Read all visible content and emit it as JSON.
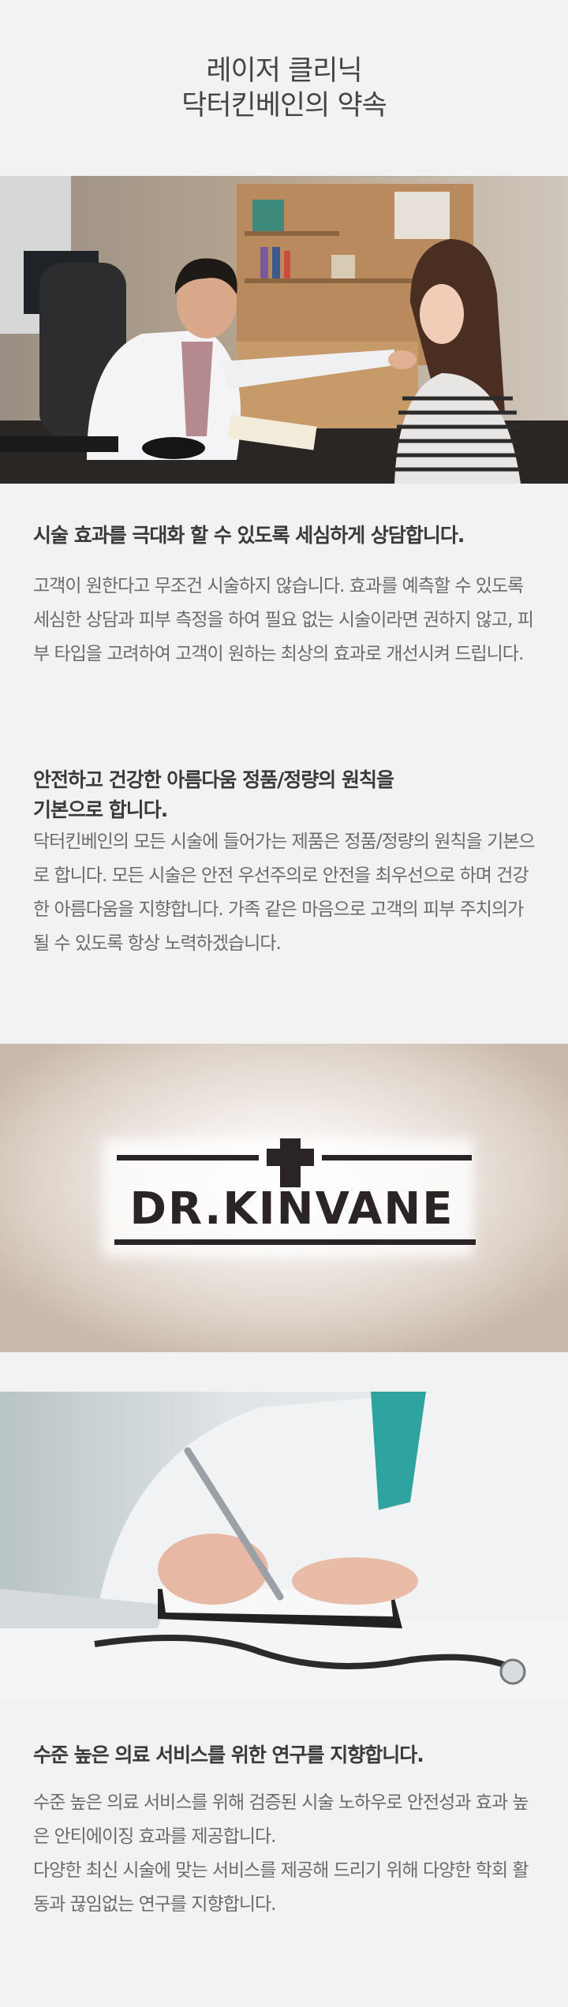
{
  "header": {
    "title_line1": "레이저 클리닉",
    "title_line2": "닥터킨베인의 약속"
  },
  "sections": [
    {
      "heading": "시술 효과를 극대화 할 수 있도록 세심하게 상담합니다.",
      "body": "고객이 원한다고 무조건 시술하지 않습니다. 효과를 예측할 수 있도록 세심한 상담과 피부 측정을 하여 필요 없는 시술이라면 권하지 않고, 피부 타입을 고려하여 고객이 원하는 최상의 효과로 개선시켜 드립니다."
    },
    {
      "heading_line1": "안전하고 건강한 아름다움 정품/정량의 원칙을",
      "heading_line2": "기본으로 합니다.",
      "body": "닥터킨베인의 모든 시술에 들어가는 제품은 정품/정량의 원칙을 기본으로 합니다. 모든 시술은 안전 우선주의로 안전을 최우선으로 하며 건강한 아름다움을 지향합니다. 가족 같은 마음으로 고객의 피부 주치의가 될 수 있도록 항상 노력하겠습니다."
    },
    {
      "heading": "수준 높은 의료 서비스를 위한 연구를 지향합니다.",
      "body_line1": "수준 높은 의료 서비스를 위해 검증된 시술 노하우로 안전성과 효과 높은 안티에이징 효과를 제공합니다.",
      "body_line2": "다양한 최신 시술에 맞는 서비스를 제공해 드리기 위해 다양한 학회 활동과 끊임없는 연구를 지향합니다."
    }
  ],
  "sign": {
    "logo_text": "DR.KINVANE"
  }
}
